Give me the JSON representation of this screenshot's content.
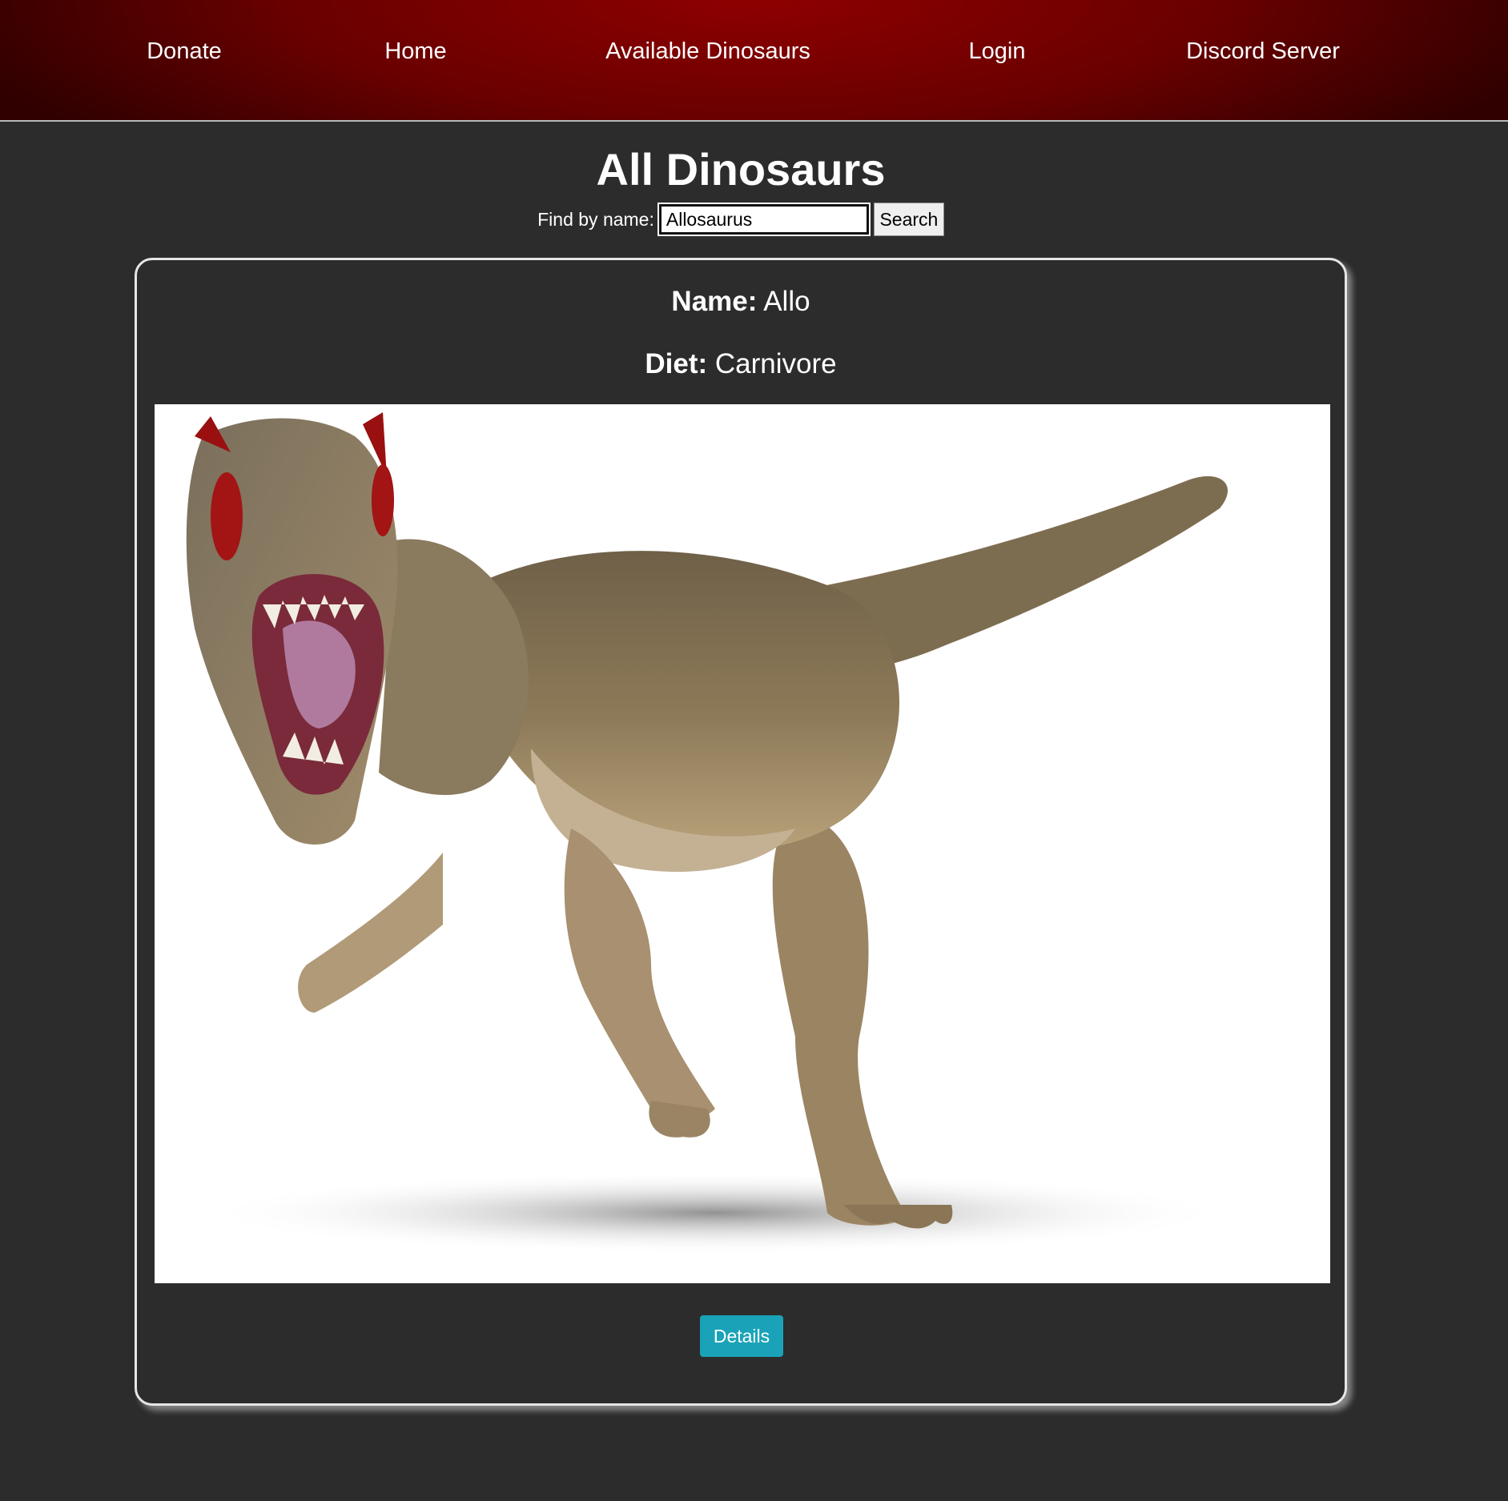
{
  "nav": {
    "items": [
      {
        "label": "Donate"
      },
      {
        "label": "Home"
      },
      {
        "label": "Available Dinosaurs"
      },
      {
        "label": "Login"
      },
      {
        "label": "Discord Server"
      }
    ]
  },
  "main": {
    "title": "All Dinosaurs",
    "search": {
      "label": "Find by name:",
      "value": "Allosaurus",
      "button_label": "Search"
    }
  },
  "card": {
    "name_key": "Name:",
    "name_value": "Allo",
    "diet_key": "Diet:",
    "diet_value": "Carnivore",
    "image_subject": "allosaurus-photo",
    "details_label": "Details"
  },
  "colors": {
    "nav_red": "#7a0000",
    "background": "#2c2c2c",
    "details_button": "#1aa3b8"
  }
}
